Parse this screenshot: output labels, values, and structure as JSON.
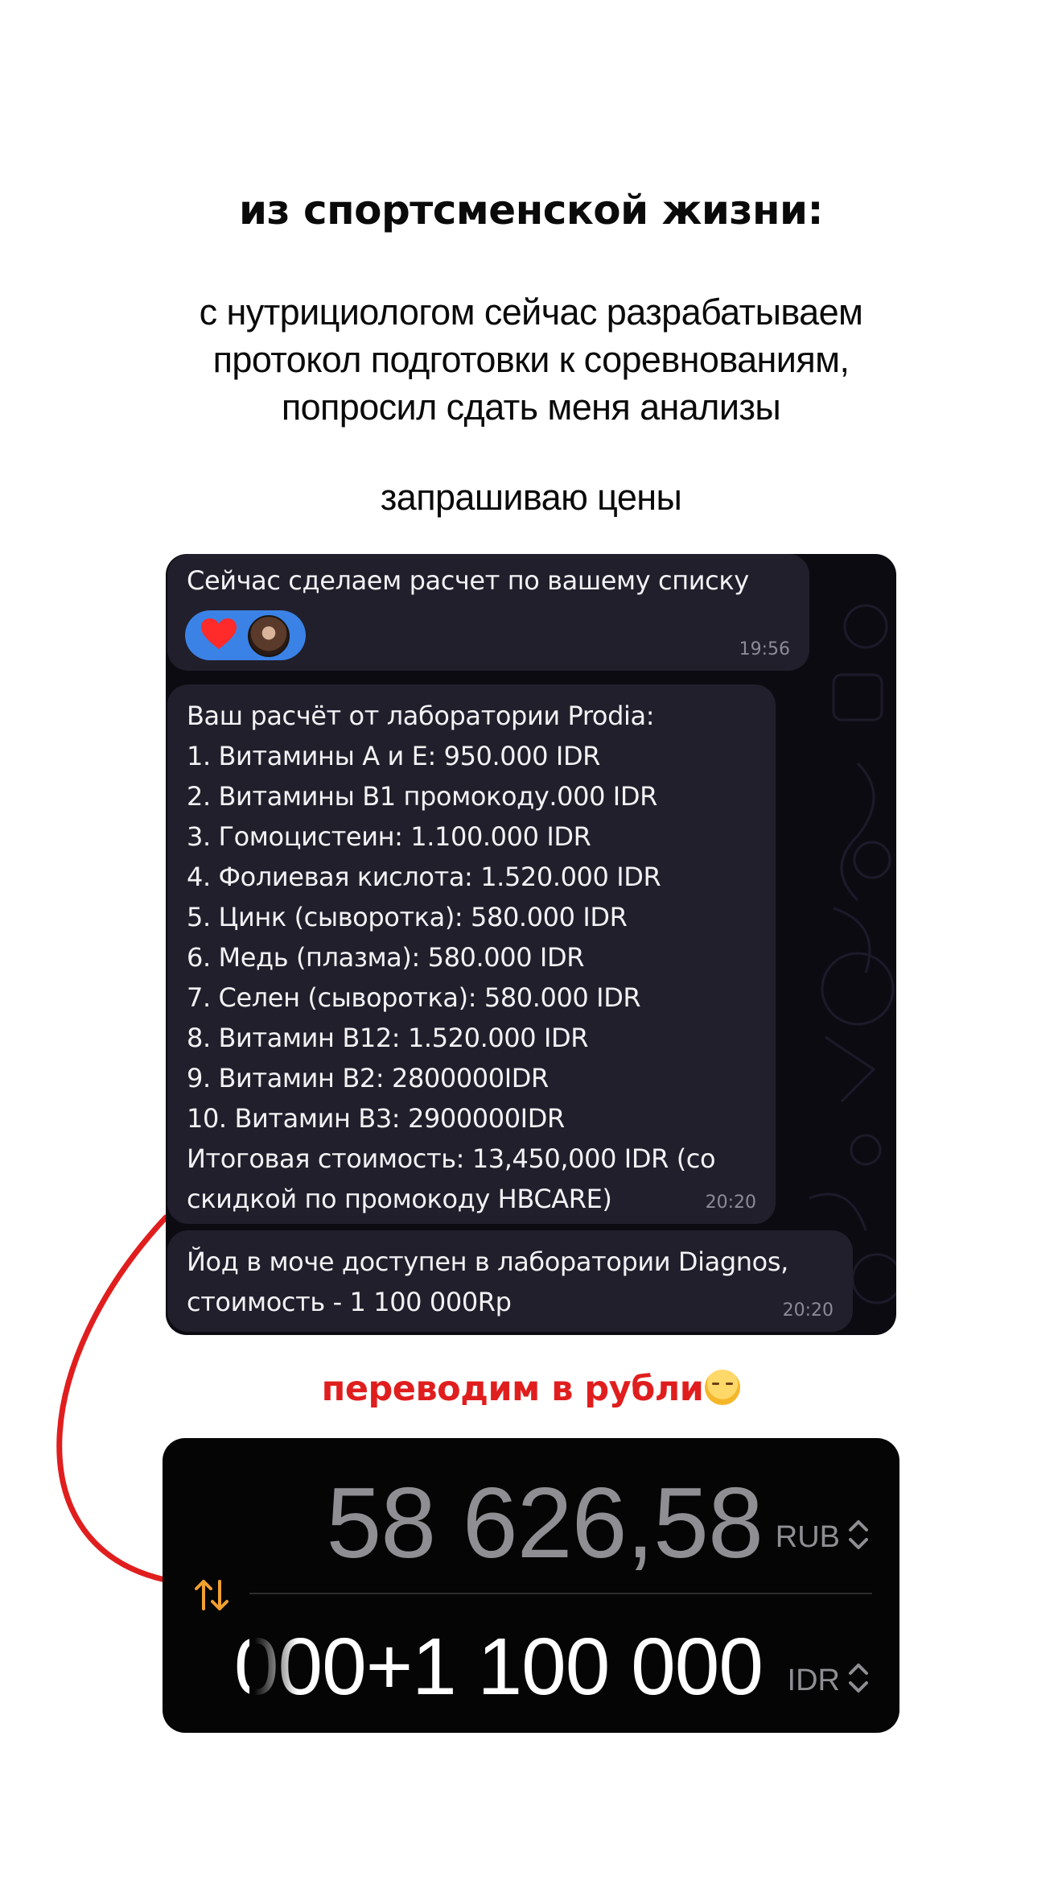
{
  "heading": "из спортсменской жизни:",
  "intro": {
    "line1": "с нутрициологом сейчас разрабатываем",
    "line2": "протокол подготовки к соревнованиям,",
    "line3": "попросил сдать меня анализы"
  },
  "ask": "запрашиваю цены",
  "chat": {
    "message1": {
      "text": "Сейчас сделаем расчет по вашему списку",
      "time": "19:56",
      "reaction": "heart-icon"
    },
    "message2": {
      "lines": [
        "Ваш расчёт от лаборатории Prodia:",
        "1. Витамины А и Е: 950.000 IDR",
        "2. Витамины В1 промокоду.000 IDR",
        "3. Гомоцистеин: 1.100.000 IDR",
        "4. Фолиевая кислота: 1.520.000 IDR",
        "5. Цинк (сыворотка): 580.000 IDR",
        "6. Медь (плазма): 580.000 IDR",
        "7. Селен (сыворотка): 580.000 IDR",
        "8. Витамин В12: 1.520.000 IDR",
        "9. Витамин В2: 2800000IDR",
        "10. Витамин В3: 2900000IDR",
        "Итоговая стоимость: 13,450,000 IDR (со",
        "скидкой по промокоду HBCARE)"
      ],
      "time": "20:20"
    },
    "message3": {
      "lines": [
        "Йод в моче доступен в лаборатории Diagnos,",
        "стоимость - 1 100 000Rp"
      ],
      "time": "20:20"
    }
  },
  "convert_label": "переводим в рубли",
  "converter": {
    "top_value": "58 626,58",
    "top_currency": "RUB",
    "bottom_value": "000+1 100 000",
    "bottom_currency": "IDR",
    "swap_icon": "swap-arrows-icon",
    "accent_color": "#f0a030"
  },
  "colors": {
    "annotation_red": "#e01e1e",
    "chat_bg": "#0d0b12",
    "bubble_bg": "#211f2b",
    "reaction_bg": "#3b82e6"
  }
}
